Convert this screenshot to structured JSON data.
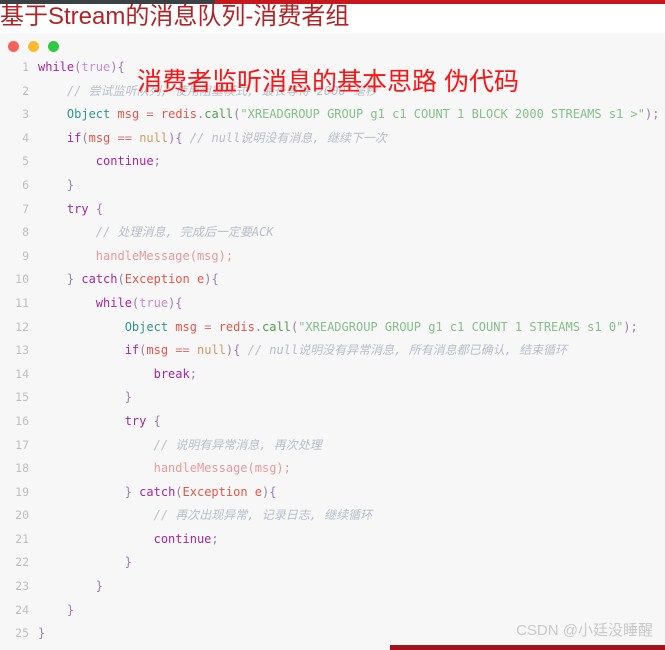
{
  "page": {
    "title": "基于Stream的消息队列-消费者组",
    "title_color": "#b32224",
    "background": "#ffffff"
  },
  "top_strip": {
    "dark_color": "#3a4145",
    "red_color": "#c8161d"
  },
  "code_card": {
    "background": "#f7f7f7",
    "window_dots": [
      {
        "name": "close",
        "color": "#fb5f57"
      },
      {
        "name": "minimize",
        "color": "#fcbb2e"
      },
      {
        "name": "maximize",
        "color": "#2ccb41"
      }
    ]
  },
  "annotation": {
    "text": "消费者监听消息的基本思路  伪代码",
    "color": "#fb1414"
  },
  "code": {
    "language": "java",
    "lines": [
      {
        "n": "1",
        "text": "while(true){"
      },
      {
        "n": "2",
        "text": "    // 尝试监听队列, 使用阻塞模式, 最长等待 2000 毫秒"
      },
      {
        "n": "3",
        "text": "    Object msg = redis.call(\"XREADGROUP GROUP g1 c1 COUNT 1 BLOCK 2000 STREAMS s1 >\");"
      },
      {
        "n": "4",
        "text": "    if(msg == null){ // null说明没有消息, 继续下一次"
      },
      {
        "n": "5",
        "text": "        continue;"
      },
      {
        "n": "6",
        "text": "    }"
      },
      {
        "n": "7",
        "text": "    try {"
      },
      {
        "n": "8",
        "text": "        // 处理消息, 完成后一定要ACK"
      },
      {
        "n": "9",
        "text": "        handleMessage(msg);"
      },
      {
        "n": "10",
        "text": "    } catch(Exception e){"
      },
      {
        "n": "11",
        "text": "        while(true){"
      },
      {
        "n": "12",
        "text": "            Object msg = redis.call(\"XREADGROUP GROUP g1 c1 COUNT 1 STREAMS s1 0\");"
      },
      {
        "n": "13",
        "text": "            if(msg == null){ // null说明没有异常消息, 所有消息都已确认, 结束循环"
      },
      {
        "n": "14",
        "text": "                break;"
      },
      {
        "n": "15",
        "text": "            }"
      },
      {
        "n": "16",
        "text": "            try {"
      },
      {
        "n": "17",
        "text": "                // 说明有异常消息, 再次处理"
      },
      {
        "n": "18",
        "text": "                handleMessage(msg);"
      },
      {
        "n": "19",
        "text": "            } catch(Exception e){"
      },
      {
        "n": "20",
        "text": "                // 再次出现异常, 记录日志, 继续循环"
      },
      {
        "n": "21",
        "text": "                continue;"
      },
      {
        "n": "22",
        "text": "            }"
      },
      {
        "n": "23",
        "text": "        }"
      },
      {
        "n": "24",
        "text": "    }"
      },
      {
        "n": "25",
        "text": "}"
      }
    ]
  },
  "watermark": {
    "text": "CSDN @小廷没睡醒",
    "color": "#c9c9c9"
  },
  "bottom_strip": {
    "color": "#a3121a"
  }
}
